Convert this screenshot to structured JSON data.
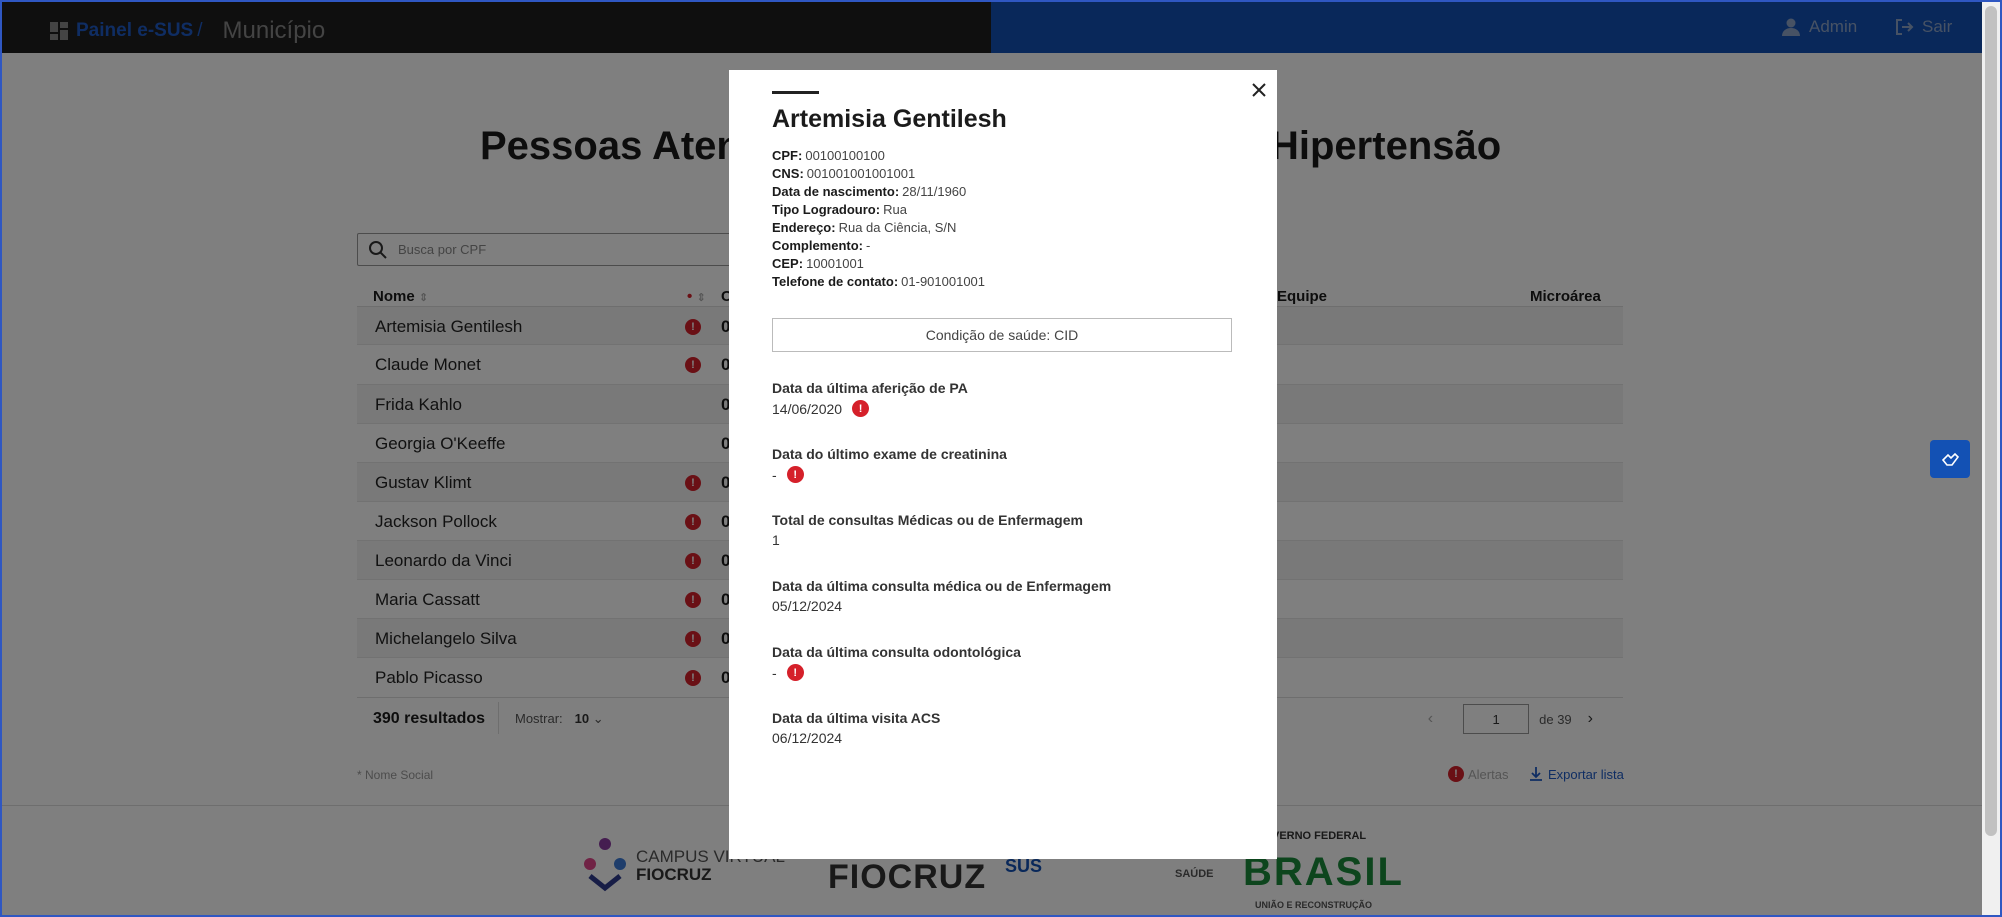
{
  "header": {
    "brand": "Painel e-SUS",
    "brand_sep": "/",
    "subtitle": "Município",
    "user_label": "Admin",
    "logout_label": "Sair"
  },
  "page": {
    "title_left": "Pessoas Aten",
    "title_right": "Hipertensão",
    "search_placeholder": "Busca por CPF"
  },
  "table": {
    "col_nome": "Nome",
    "col_c": "C",
    "col_equipe": "Equipe",
    "col_microarea": "Microárea",
    "rows": [
      {
        "nome": "Artemisia Gentilesh",
        "alert": true,
        "c": "0"
      },
      {
        "nome": "Claude Monet",
        "alert": true,
        "c": "0"
      },
      {
        "nome": "Frida Kahlo",
        "alert": false,
        "c": "0"
      },
      {
        "nome": "Georgia O'Keeffe",
        "alert": false,
        "c": "0"
      },
      {
        "nome": "Gustav Klimt",
        "alert": true,
        "c": "0"
      },
      {
        "nome": "Jackson Pollock",
        "alert": true,
        "c": "0"
      },
      {
        "nome": "Leonardo da Vinci",
        "alert": true,
        "c": "0"
      },
      {
        "nome": "Maria Cassatt",
        "alert": true,
        "c": "0"
      },
      {
        "nome": "Michelangelo Silva",
        "alert": true,
        "c": "0"
      },
      {
        "nome": "Pablo Picasso",
        "alert": true,
        "c": "0"
      }
    ],
    "results": "390 resultados",
    "mostrar_label": "Mostrar:",
    "mostrar_value": "10",
    "page_current": "1",
    "page_total": "de 39"
  },
  "footer_notes": {
    "nome_social": "* Nome Social",
    "alertas": "Alertas",
    "exportar": "Exportar lista"
  },
  "footer_logos": {
    "campus_line1": "CAMPUS VIRTUAL",
    "campus_line2": "FIOCRUZ",
    "fiocruz": "FIOCRUZ",
    "sus": "SUS",
    "saude": "SAÚDE",
    "gov_top": "VERNO FEDERAL",
    "gov_main": "BRASIL",
    "gov_bottom": "UNIÃO E RECONSTRUÇÃO"
  },
  "modal": {
    "name": "Artemisia Gentilesh",
    "info": [
      {
        "label": "CPF:",
        "value": "00100100100"
      },
      {
        "label": "CNS:",
        "value": "001001001001001"
      },
      {
        "label": "Data de nascimento:",
        "value": "28/11/1960"
      },
      {
        "label": "Tipo Logradouro:",
        "value": "Rua"
      },
      {
        "label": "Endereço:",
        "value": "Rua da Ciência, S/N"
      },
      {
        "label": "Complemento:",
        "value": "-"
      },
      {
        "label": "CEP:",
        "value": "10001001"
      },
      {
        "label": "Telefone de contato:",
        "value": "01-901001001"
      }
    ],
    "condition_button": "Condição de saúde: CID",
    "fields": [
      {
        "label": "Data da última aferição de PA",
        "value": "14/06/2020",
        "alert": true
      },
      {
        "label": "Data do último exame de creatinina",
        "value": "-",
        "alert": true
      },
      {
        "label": "Total de consultas Médicas ou de Enfermagem",
        "value": "1",
        "alert": false
      },
      {
        "label": "Data da última consulta médica ou de Enfermagem",
        "value": "05/12/2024",
        "alert": false
      },
      {
        "label": "Data da última consulta odontológica",
        "value": "-",
        "alert": true
      },
      {
        "label": "Data da última visita ACS",
        "value": "06/12/2024",
        "alert": false
      }
    ]
  },
  "alert_glyph": "!",
  "colors": {
    "header_dark": "#1f1f1f",
    "header_blue": "#1351b4",
    "alert_red": "#d5202a",
    "link_blue": "#1e5bc6"
  }
}
